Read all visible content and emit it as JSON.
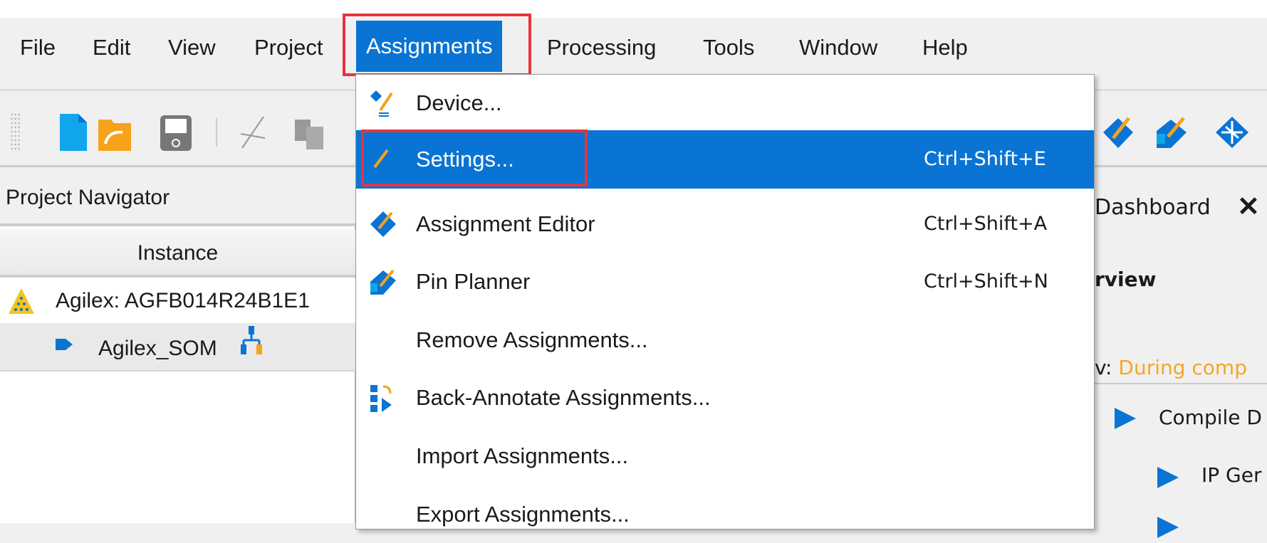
{
  "menubar": {
    "items": [
      "File",
      "Edit",
      "View",
      "Project",
      "Assignments",
      "Processing",
      "Tools",
      "Window",
      "Help"
    ],
    "active": "Assignments"
  },
  "toolbar": {
    "icons": [
      "grip-icon",
      "new-file-icon",
      "open-folder-icon",
      "save-icon",
      "cut-icon",
      "copy-icon",
      "assignment-editor-icon",
      "pin-planner-icon",
      "chip-planner-icon"
    ]
  },
  "navigator": {
    "title": "Project Navigator",
    "column": "Instance",
    "rows": [
      {
        "label": "Agilex: AGFB014R24B1E1"
      },
      {
        "label": "Agilex_SOM"
      }
    ]
  },
  "dropdown": {
    "items": [
      {
        "label": "Device...",
        "shortcut": "",
        "icon": "device-icon"
      },
      {
        "label": "Settings...",
        "shortcut": "Ctrl+Shift+E",
        "icon": "settings-pencil-icon"
      },
      {
        "label": "Assignment Editor",
        "shortcut": "Ctrl+Shift+A",
        "icon": "assignment-editor-icon"
      },
      {
        "label": "Pin Planner",
        "shortcut": "Ctrl+Shift+N",
        "icon": "pin-planner-icon"
      },
      {
        "label": "Remove Assignments...",
        "shortcut": ""
      },
      {
        "label": "Back-Annotate Assignments...",
        "shortcut": "",
        "icon": "back-annotate-icon"
      },
      {
        "label": "Import Assignments...",
        "shortcut": ""
      },
      {
        "label": "Export Assignments...",
        "shortcut": ""
      }
    ]
  },
  "dashboard": {
    "tab": "Dashboard",
    "close": "✕",
    "heading": "rview",
    "status_prefix": "v:",
    "status": "During comp",
    "flow": [
      "Compile D",
      "IP Ger"
    ]
  },
  "colors": {
    "accent": "#0a74d4",
    "highlight_box": "#e8333b",
    "status": "#f5a623"
  }
}
